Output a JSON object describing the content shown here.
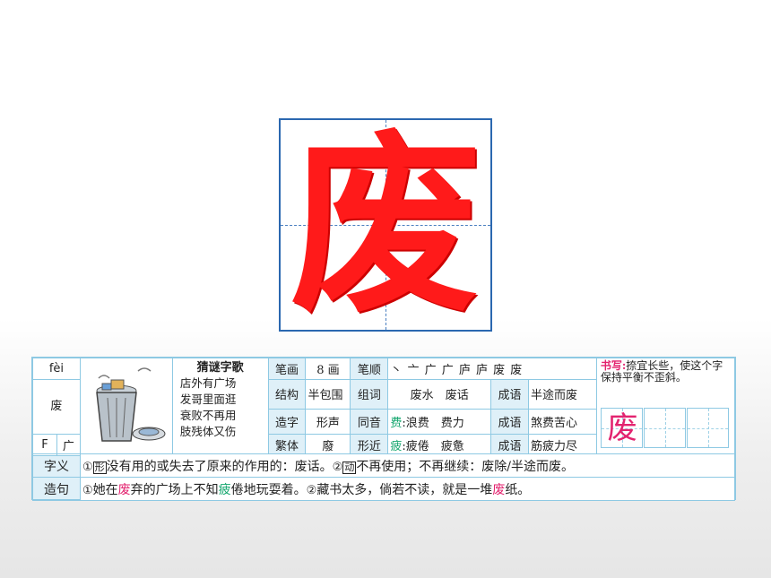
{
  "character": "废",
  "pinyin": "fèi",
  "radical_letter": "F",
  "radical": "广",
  "riddle": {
    "title": "猜谜字歌",
    "lines": [
      "店外有广场",
      "发哥里面逛",
      "衰败不再用",
      "肢残体又伤"
    ]
  },
  "strokes": {
    "label": "笔画",
    "value": "8 画"
  },
  "stroke_order": {
    "label": "笔顺",
    "sequence": "丶 亠 广 广 庐 庐 废 废"
  },
  "structure": {
    "label": "结构",
    "value": "半包围"
  },
  "words": {
    "label": "组词",
    "items": [
      "废水",
      "废话"
    ]
  },
  "idioms": [
    {
      "label": "成语",
      "value": "半途而废"
    },
    {
      "label": "成语",
      "value": "煞费苦心"
    },
    {
      "label": "成语",
      "value": "筋疲力尽"
    }
  ],
  "formation": {
    "label": "造字",
    "value": "形声"
  },
  "homophone": {
    "label": "同音",
    "char": "费",
    "colon": ":",
    "words": "浪费　费力"
  },
  "traditional": {
    "label": "繁体",
    "value": "廢"
  },
  "similar": {
    "label": "形近",
    "char": "疲",
    "colon": ":",
    "words": "疲倦　疲惫"
  },
  "writing": {
    "label": "书写:",
    "note": "捺宜长些，使这个字保持平衡不歪斜。",
    "sample_char": "废"
  },
  "meaning": {
    "label": "字义",
    "n1": "①",
    "pos1": "形",
    "text1": "没有用的或失去了原来的作用的：废话。",
    "n2": "②",
    "pos2": "动",
    "text2": "不再使用；不再继续：废除/半途而废。"
  },
  "sentence": {
    "label": "造句",
    "n1": "①",
    "s1_a": "她在",
    "s1_b": "废",
    "s1_c": "弃的广场上不知",
    "s1_d": "疲",
    "s1_e": "倦地玩耍着。",
    "n2": "②",
    "s2_a": "藏书太多，倘若不读，就是一堆",
    "s2_b": "废",
    "s2_c": "纸。"
  },
  "colors": {
    "accent_red": "#ff1a1a",
    "pink": "#e3236f",
    "green": "#14a66e",
    "frame_blue": "#2b68b0",
    "card_bg": "#dff0f8"
  }
}
